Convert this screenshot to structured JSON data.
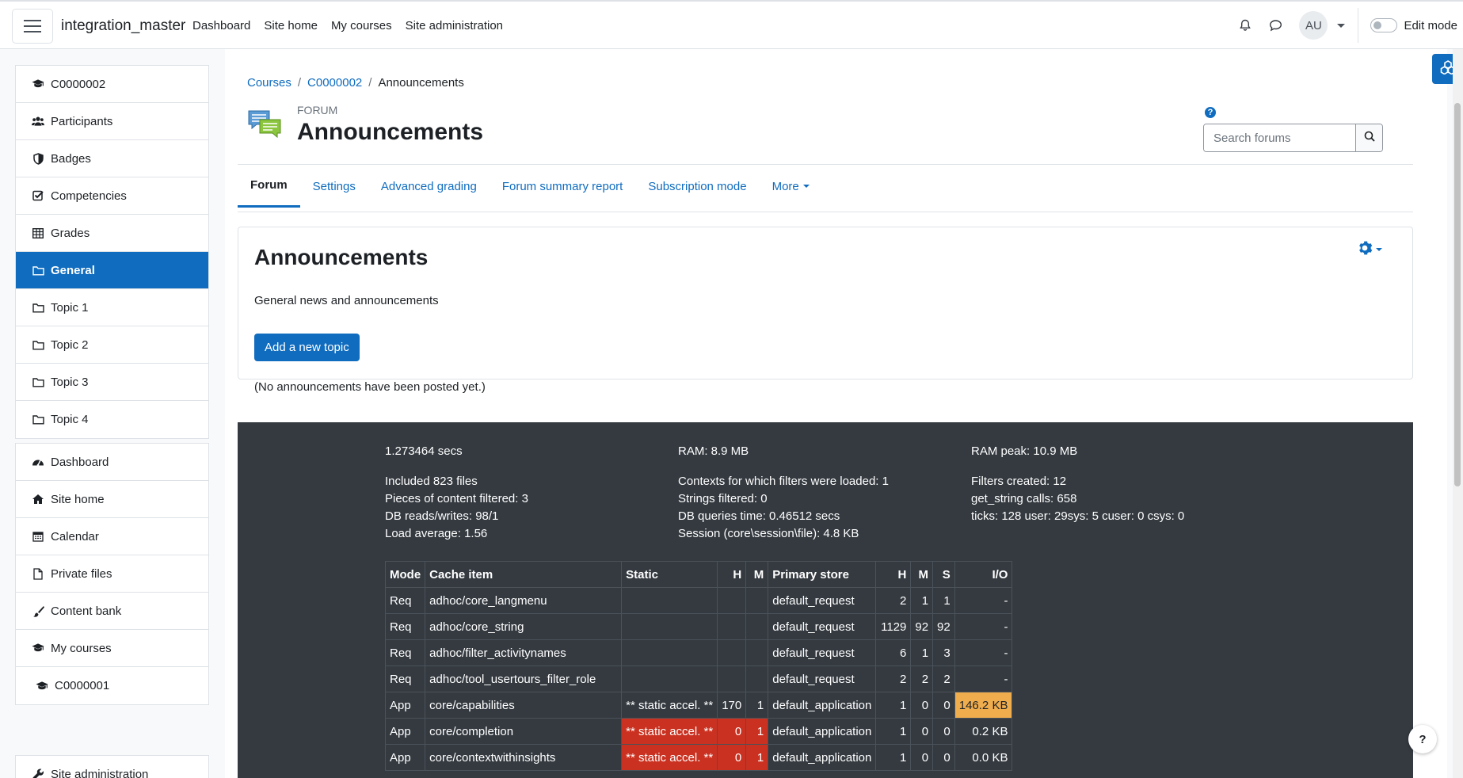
{
  "navbar": {
    "site_name": "integration_master",
    "links": [
      "Dashboard",
      "Site home",
      "My courses",
      "Site administration"
    ],
    "user_initials": "AU",
    "edit_mode_label": "Edit mode"
  },
  "drawer": {
    "course_items": [
      {
        "label": "C0000002",
        "icon": "graduation-cap-icon"
      },
      {
        "label": "Participants",
        "icon": "users-icon"
      },
      {
        "label": "Badges",
        "icon": "shield-icon"
      },
      {
        "label": "Competencies",
        "icon": "checkbox-icon"
      },
      {
        "label": "Grades",
        "icon": "table-icon"
      },
      {
        "label": "General",
        "icon": "folder-icon",
        "active": true
      },
      {
        "label": "Topic 1",
        "icon": "folder-icon"
      },
      {
        "label": "Topic 2",
        "icon": "folder-icon"
      },
      {
        "label": "Topic 3",
        "icon": "folder-icon"
      },
      {
        "label": "Topic 4",
        "icon": "folder-icon"
      }
    ],
    "site_items": [
      {
        "label": "Dashboard",
        "icon": "tachometer-icon"
      },
      {
        "label": "Site home",
        "icon": "home-icon"
      },
      {
        "label": "Calendar",
        "icon": "calendar-icon"
      },
      {
        "label": "Private files",
        "icon": "file-icon"
      },
      {
        "label": "Content bank",
        "icon": "paint-brush-icon"
      },
      {
        "label": "My courses",
        "icon": "graduation-cap-icon"
      },
      {
        "label": "C0000001",
        "icon": "graduation-cap-icon"
      }
    ],
    "admin_item": {
      "label": "Site administration",
      "icon": "wrench-icon"
    }
  },
  "breadcrumb": [
    "Courses",
    "C0000002",
    "Announcements"
  ],
  "header": {
    "kicker": "FORUM",
    "title": "Announcements",
    "search_placeholder": "Search forums"
  },
  "tabs": [
    "Forum",
    "Settings",
    "Advanced grading",
    "Forum summary report",
    "Subscription mode",
    "More"
  ],
  "card": {
    "title": "Announcements",
    "description": "General news and announcements",
    "add_button": "Add a new topic",
    "empty_message": "(No announcements have been posted yet.)"
  },
  "perf": {
    "col1": [
      "1.273464 secs",
      "Included 823 files",
      "Pieces of content filtered: 3",
      "DB reads/writes: 98/1",
      "Load average: 1.56"
    ],
    "col2": [
      "RAM: 8.9 MB",
      "Contexts for which filters were loaded: 1",
      "Strings filtered: 0",
      "DB queries time: 0.46512 secs",
      "Session (core\\session\\file): 4.8 KB"
    ],
    "col3": [
      "RAM peak: 10.9 MB",
      "Filters created: 12",
      "get_string calls: 658",
      "ticks: 128 user: 29sys: 5 cuser: 0 csys: 0"
    ],
    "table_headers": [
      "Mode",
      "Cache item",
      "Static",
      "H",
      "M",
      "Primary store",
      "H",
      "M",
      "S",
      "I/O"
    ],
    "rows": [
      [
        "Req",
        "adhoc/core_langmenu",
        "",
        "",
        "",
        "default_request",
        "2",
        "1",
        "1",
        "-"
      ],
      [
        "Req",
        "adhoc/core_string",
        "",
        "",
        "",
        "default_request",
        "1129",
        "92",
        "92",
        "-"
      ],
      [
        "Req",
        "adhoc/filter_activitynames",
        "",
        "",
        "",
        "default_request",
        "6",
        "1",
        "3",
        "-"
      ],
      [
        "Req",
        "adhoc/tool_usertours_filter_role",
        "",
        "",
        "",
        "default_request",
        "2",
        "2",
        "2",
        "-"
      ],
      [
        "App",
        "core/capabilities",
        "** static accel. **",
        "170",
        "1",
        "default_application",
        "1",
        "0",
        "0",
        "146.2 KB"
      ],
      [
        "App",
        "core/completion",
        "** static accel. **",
        "0",
        "1",
        "default_application",
        "1",
        "0",
        "0",
        "0.2 KB"
      ],
      [
        "App",
        "core/contextwithinsights",
        "** static accel. **",
        "0",
        "1",
        "default_application",
        "1",
        "0",
        "0",
        "0.0 KB"
      ]
    ]
  },
  "help_label": "?"
}
